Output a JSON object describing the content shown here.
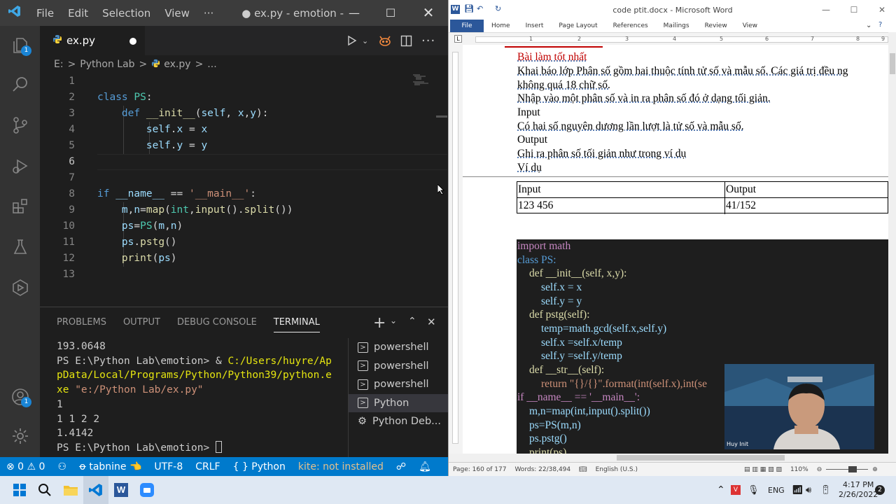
{
  "vscode": {
    "title_bar": {
      "menus": [
        "File",
        "Edit",
        "Selection",
        "View",
        "···"
      ],
      "title": "● ex.py - emotion - V..."
    },
    "activity_badges": {
      "explorer": "1",
      "accounts": "1"
    },
    "tab": {
      "label": "ex.py"
    },
    "breadcrumb": {
      "drive": "E:",
      "sep1": ">",
      "folder": "Python Lab",
      "sep2": ">",
      "file": "ex.py",
      "sep3": ">",
      "more": "..."
    },
    "line_numbers": [
      "1",
      "2",
      "3",
      "4",
      "5",
      "6",
      "7",
      "8",
      "9",
      "10",
      "11",
      "12",
      "13"
    ],
    "panel": {
      "tabs": [
        "PROBLEMS",
        "OUTPUT",
        "DEBUG CONSOLE",
        "TERMINAL"
      ],
      "active_tab": "TERMINAL",
      "terminal_lines": {
        "l1": "193.0648",
        "l2a": "PS E:\\Python Lab\\emotion> & ",
        "l2b": "C:/Users/huyre/Ap",
        "l3": "pData/Local/Programs/Python/Python39/python.e",
        "l4a": "xe",
        "l4b": " \"e:/Python Lab/ex.py\"",
        "l5": "1",
        "l6": "1 1 2 2",
        "l7": "1.4142",
        "l8": "PS E:\\Python Lab\\emotion> "
      },
      "terminal_list": [
        "powershell",
        "powershell",
        "powershell",
        "Python",
        "Python Deb..."
      ]
    },
    "status_bar": {
      "problems": "⊗ 0 ⚠ 0",
      "tabnine": "ꝋ tabnine 👈",
      "encoding": "UTF-8",
      "eol": "CRLF",
      "language": "{ } Python",
      "kite": "kite: not installed"
    }
  },
  "word": {
    "title": "code ptit.docx - Microsoft Word",
    "ribbon_tabs": [
      "File",
      "Home",
      "Insert",
      "Page Layout",
      "References",
      "Mailings",
      "Review",
      "View"
    ],
    "ruler_numbers": [
      "1",
      "2",
      "3",
      "4",
      "5",
      "6",
      "7",
      "8",
      "9"
    ],
    "doc_lines": {
      "bai_lam": "Bài làm tốt nhất",
      "desc1": "Khai báo lớp Phân số gồm hai thuộc tính tử số và mẫu số. Các giá trị đều ng",
      "desc2": "không quá 18 chữ số.",
      "desc3": "Nhập vào một phân số và in ra phân số đó ở dạng tối giản.",
      "input": "Input",
      "input_desc": "Có hai số nguyên dương lần lượt là tử số và mẫu số.",
      "output": "Output",
      "output_desc": "Ghi ra phân số tối giản như trong ví dụ",
      "vi_du": "Ví dụ"
    },
    "example_table": {
      "headers": [
        "Input",
        "Output"
      ],
      "rows": [
        [
          "123 456",
          "41/152"
        ]
      ]
    },
    "code_lines": {
      "c1": "import math",
      "c2": "class PS:",
      "c3": "def __init__(self, x,y):",
      "c4": "self.x = x",
      "c5": "self.y = y",
      "c6": "def pstg(self):",
      "c7": "temp=math.gcd(self.x,self.y)",
      "c8": "self.x =self.x/temp",
      "c9": "self.y =self.y/temp",
      "c10": "def __str__(self):",
      "c11": "return \"{}/{}\".format(int(self.x),int(se",
      "c12": "if __name__ == '__main__':",
      "c13": "m,n=map(int,input().split())",
      "c14": "ps=PS(m,n)",
      "c15": "ps.pstg()",
      "c16": "print(ps)"
    },
    "webcam_name": "Huy Init",
    "status": {
      "page": "Page: 160 of 177",
      "words": "Words: 22/38,494",
      "lang": "English (U.S.)",
      "zoom": "110%"
    }
  },
  "taskbar": {
    "lang": "ENG",
    "time": "4:17 PM",
    "date": "2/26/2022",
    "notifications": "2"
  }
}
